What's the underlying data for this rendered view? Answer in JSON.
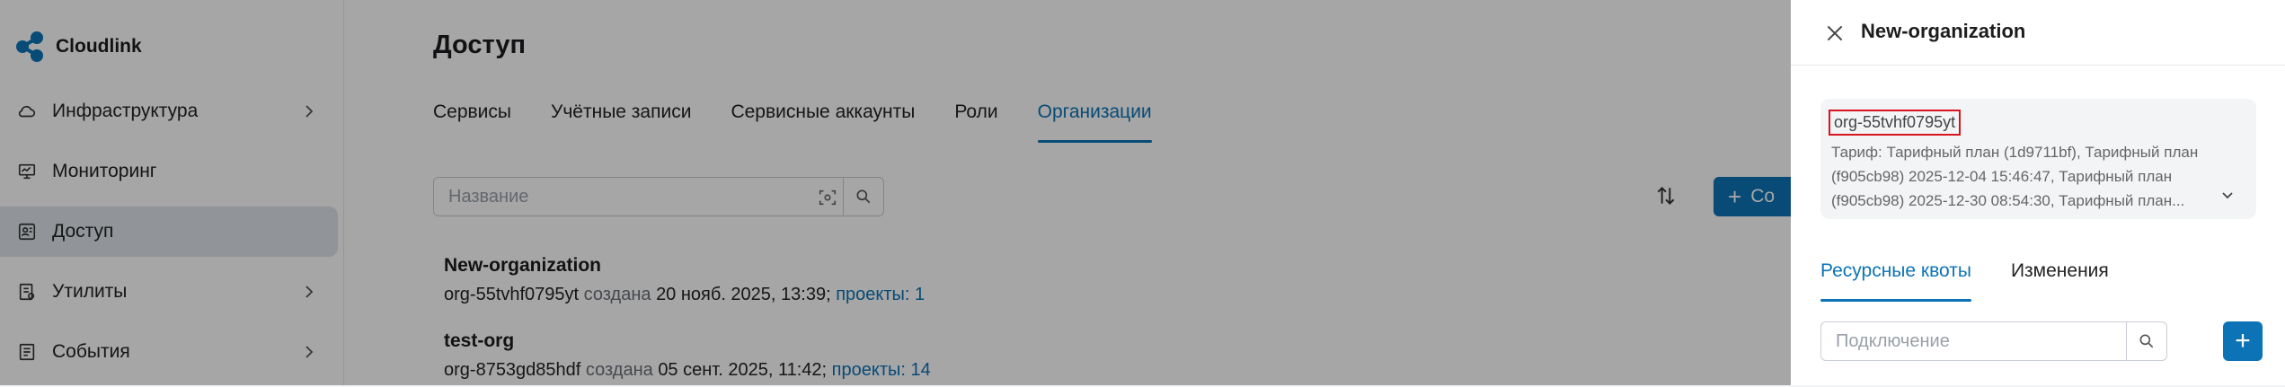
{
  "app": {
    "name": "Cloudlink"
  },
  "colors": {
    "accent": "#0c74b6",
    "highlight_border": "#d9141e"
  },
  "sidebar": {
    "items": [
      {
        "label": "Инфраструктура",
        "icon": "cloud-icon",
        "has_submenu": true
      },
      {
        "label": "Мониторинг",
        "icon": "monitor-icon",
        "has_submenu": false
      },
      {
        "label": "Доступ",
        "icon": "access-icon",
        "has_submenu": false,
        "active": true
      },
      {
        "label": "Утилиты",
        "icon": "tools-icon",
        "has_submenu": true
      },
      {
        "label": "События",
        "icon": "events-icon",
        "has_submenu": true
      }
    ]
  },
  "main": {
    "title": "Доступ",
    "tabs": [
      {
        "label": "Сервисы"
      },
      {
        "label": "Учётные записи"
      },
      {
        "label": "Сервисные аккаунты"
      },
      {
        "label": "Роли"
      },
      {
        "label": "Организации",
        "active": true
      }
    ],
    "search": {
      "placeholder": "Название",
      "value": ""
    },
    "create_label": "Со",
    "rows": [
      {
        "name": "New-organization",
        "id": "org-55tvhf0795yt",
        "created_label": "создана",
        "created": "20 нояб. 2025, 13:39",
        "separator": ";",
        "projects": "проекты: 1"
      },
      {
        "name": "test-org",
        "id": "org-8753gd85hdf",
        "created_label": "создана",
        "created": "05 сент. 2025, 11:42",
        "separator": ";",
        "projects": "проекты: 14"
      }
    ]
  },
  "panel": {
    "title": "New-organization",
    "org_id": "org-55tvhf0795yt",
    "tariff_text": "Тариф: Тарифный план (1d9711bf), Тарифный план (f905cb98) 2025-12-04 15:46:47, Тарифный план (f905cb98) 2025-12-30 08:54:30, Тарифный план...",
    "tabs": [
      {
        "label": "Ресурсные квоты",
        "active": true
      },
      {
        "label": "Изменения"
      }
    ],
    "search": {
      "placeholder": "Подключение",
      "value": ""
    }
  }
}
